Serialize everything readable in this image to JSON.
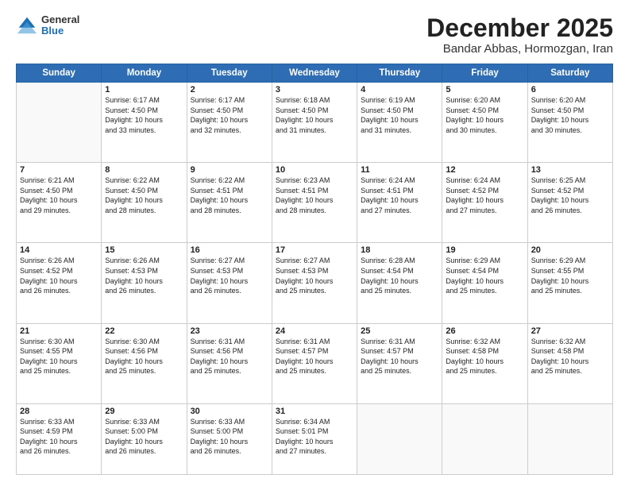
{
  "logo": {
    "general": "General",
    "blue": "Blue"
  },
  "header": {
    "title": "December 2025",
    "subtitle": "Bandar Abbas, Hormozgan, Iran"
  },
  "days_of_week": [
    "Sunday",
    "Monday",
    "Tuesday",
    "Wednesday",
    "Thursday",
    "Friday",
    "Saturday"
  ],
  "weeks": [
    [
      {
        "day": "",
        "info": ""
      },
      {
        "day": "1",
        "info": "Sunrise: 6:17 AM\nSunset: 4:50 PM\nDaylight: 10 hours\nand 33 minutes."
      },
      {
        "day": "2",
        "info": "Sunrise: 6:17 AM\nSunset: 4:50 PM\nDaylight: 10 hours\nand 32 minutes."
      },
      {
        "day": "3",
        "info": "Sunrise: 6:18 AM\nSunset: 4:50 PM\nDaylight: 10 hours\nand 31 minutes."
      },
      {
        "day": "4",
        "info": "Sunrise: 6:19 AM\nSunset: 4:50 PM\nDaylight: 10 hours\nand 31 minutes."
      },
      {
        "day": "5",
        "info": "Sunrise: 6:20 AM\nSunset: 4:50 PM\nDaylight: 10 hours\nand 30 minutes."
      },
      {
        "day": "6",
        "info": "Sunrise: 6:20 AM\nSunset: 4:50 PM\nDaylight: 10 hours\nand 30 minutes."
      }
    ],
    [
      {
        "day": "7",
        "info": "Sunrise: 6:21 AM\nSunset: 4:50 PM\nDaylight: 10 hours\nand 29 minutes."
      },
      {
        "day": "8",
        "info": "Sunrise: 6:22 AM\nSunset: 4:50 PM\nDaylight: 10 hours\nand 28 minutes."
      },
      {
        "day": "9",
        "info": "Sunrise: 6:22 AM\nSunset: 4:51 PM\nDaylight: 10 hours\nand 28 minutes."
      },
      {
        "day": "10",
        "info": "Sunrise: 6:23 AM\nSunset: 4:51 PM\nDaylight: 10 hours\nand 28 minutes."
      },
      {
        "day": "11",
        "info": "Sunrise: 6:24 AM\nSunset: 4:51 PM\nDaylight: 10 hours\nand 27 minutes."
      },
      {
        "day": "12",
        "info": "Sunrise: 6:24 AM\nSunset: 4:52 PM\nDaylight: 10 hours\nand 27 minutes."
      },
      {
        "day": "13",
        "info": "Sunrise: 6:25 AM\nSunset: 4:52 PM\nDaylight: 10 hours\nand 26 minutes."
      }
    ],
    [
      {
        "day": "14",
        "info": "Sunrise: 6:26 AM\nSunset: 4:52 PM\nDaylight: 10 hours\nand 26 minutes."
      },
      {
        "day": "15",
        "info": "Sunrise: 6:26 AM\nSunset: 4:53 PM\nDaylight: 10 hours\nand 26 minutes."
      },
      {
        "day": "16",
        "info": "Sunrise: 6:27 AM\nSunset: 4:53 PM\nDaylight: 10 hours\nand 26 minutes."
      },
      {
        "day": "17",
        "info": "Sunrise: 6:27 AM\nSunset: 4:53 PM\nDaylight: 10 hours\nand 25 minutes."
      },
      {
        "day": "18",
        "info": "Sunrise: 6:28 AM\nSunset: 4:54 PM\nDaylight: 10 hours\nand 25 minutes."
      },
      {
        "day": "19",
        "info": "Sunrise: 6:29 AM\nSunset: 4:54 PM\nDaylight: 10 hours\nand 25 minutes."
      },
      {
        "day": "20",
        "info": "Sunrise: 6:29 AM\nSunset: 4:55 PM\nDaylight: 10 hours\nand 25 minutes."
      }
    ],
    [
      {
        "day": "21",
        "info": "Sunrise: 6:30 AM\nSunset: 4:55 PM\nDaylight: 10 hours\nand 25 minutes."
      },
      {
        "day": "22",
        "info": "Sunrise: 6:30 AM\nSunset: 4:56 PM\nDaylight: 10 hours\nand 25 minutes."
      },
      {
        "day": "23",
        "info": "Sunrise: 6:31 AM\nSunset: 4:56 PM\nDaylight: 10 hours\nand 25 minutes."
      },
      {
        "day": "24",
        "info": "Sunrise: 6:31 AM\nSunset: 4:57 PM\nDaylight: 10 hours\nand 25 minutes."
      },
      {
        "day": "25",
        "info": "Sunrise: 6:31 AM\nSunset: 4:57 PM\nDaylight: 10 hours\nand 25 minutes."
      },
      {
        "day": "26",
        "info": "Sunrise: 6:32 AM\nSunset: 4:58 PM\nDaylight: 10 hours\nand 25 minutes."
      },
      {
        "day": "27",
        "info": "Sunrise: 6:32 AM\nSunset: 4:58 PM\nDaylight: 10 hours\nand 25 minutes."
      }
    ],
    [
      {
        "day": "28",
        "info": "Sunrise: 6:33 AM\nSunset: 4:59 PM\nDaylight: 10 hours\nand 26 minutes."
      },
      {
        "day": "29",
        "info": "Sunrise: 6:33 AM\nSunset: 5:00 PM\nDaylight: 10 hours\nand 26 minutes."
      },
      {
        "day": "30",
        "info": "Sunrise: 6:33 AM\nSunset: 5:00 PM\nDaylight: 10 hours\nand 26 minutes."
      },
      {
        "day": "31",
        "info": "Sunrise: 6:34 AM\nSunset: 5:01 PM\nDaylight: 10 hours\nand 27 minutes."
      },
      {
        "day": "",
        "info": ""
      },
      {
        "day": "",
        "info": ""
      },
      {
        "day": "",
        "info": ""
      }
    ]
  ]
}
